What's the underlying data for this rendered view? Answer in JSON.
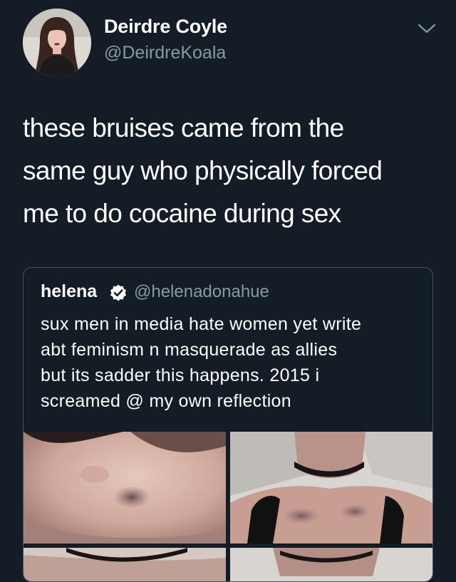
{
  "tweet": {
    "author": {
      "display_name": "Deirdre Coyle",
      "handle": "@DeirdreKoala"
    },
    "text_lines": [
      "these bruises came from the",
      "same guy who physically forced",
      "me to do cocaine during sex"
    ],
    "menu_icon": "chevron-down-icon"
  },
  "quoted": {
    "author": {
      "display_name": "helena",
      "handle": "@helenadonahue",
      "verified": true,
      "verified_icon": "verified-badge-icon"
    },
    "text_lines": [
      "sux men in media hate women yet write",
      "abt feminism n masquerade as allies",
      "but its sadder this happens. 2015 i",
      "screamed @ my own reflection"
    ],
    "media": [
      "chin-bruise-photo",
      "collarbone-bruise-photo",
      "photo-3",
      "photo-4"
    ]
  },
  "colors": {
    "background": "#141d26",
    "text": "#ffffff",
    "secondary_text": "#8899a6",
    "card_border": "#3d5466",
    "verified_badge": "#ffffff"
  }
}
